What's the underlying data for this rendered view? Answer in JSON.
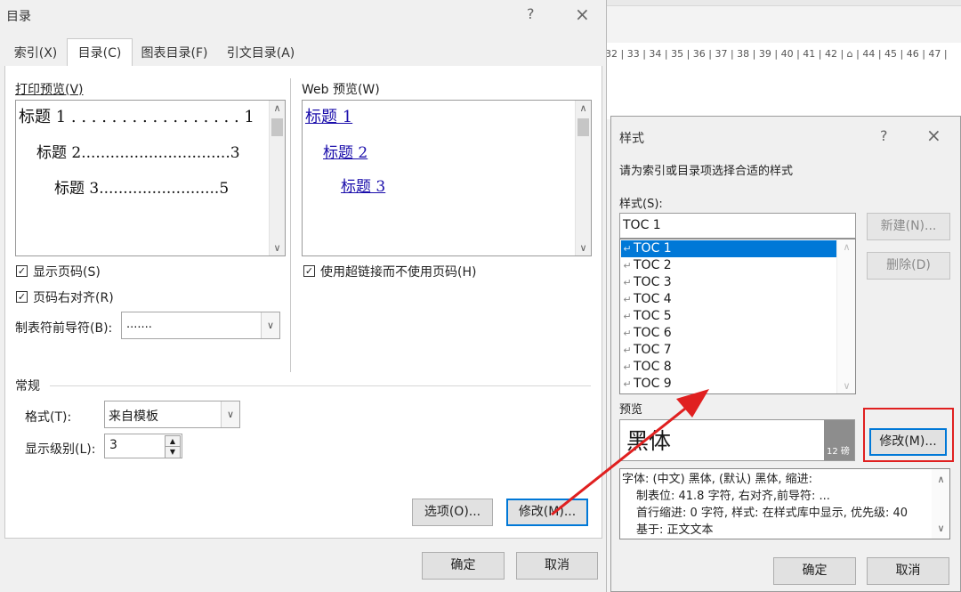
{
  "background": {
    "ruler_text": "32 | 33 | 34 | 35 | 36 | 37 | 38 | 39 | 40 | 41 | 42 |  ⌂ | 44 | 45 | 46 | 47 |"
  },
  "toc_dialog": {
    "title": "目录",
    "help": "?",
    "close": "×",
    "tabs": [
      {
        "label": "索引(X)"
      },
      {
        "label": "目录(C)"
      },
      {
        "label": "图表目录(F)"
      },
      {
        "label": "引文目录(A)"
      }
    ],
    "print_preview": {
      "label": "打印预览(V)",
      "lines": [
        "标题 1 . . . . . . . . . . . . . . . . . 1",
        "标题  2...............................3",
        "标题  3.........................5"
      ]
    },
    "web_preview": {
      "label": "Web 预览(W)",
      "links": [
        "标题 1",
        "标题 2",
        "标题 3"
      ]
    },
    "show_page_numbers": {
      "label": "显示页码(S)",
      "checked": true
    },
    "right_align": {
      "label": "页码右对齐(R)",
      "checked": true
    },
    "tab_leader": {
      "label": "制表符前导符(B):",
      "value": "......."
    },
    "use_hyperlinks": {
      "label": "使用超链接而不使用页码(H)",
      "checked": true
    },
    "general": {
      "label": "常规",
      "format_label": "格式(T):",
      "format_value": "来自模板",
      "levels_label": "显示级别(L):",
      "levels_value": "3"
    },
    "options_button": "选项(O)...",
    "modify_button": "修改(M)...",
    "ok_button": "确定",
    "cancel_button": "取消"
  },
  "style_dialog": {
    "title": "样式",
    "help": "?",
    "close": "×",
    "instruction": "请为索引或目录项选择合适的样式",
    "styles_label": "样式(S):",
    "style_input": "TOC 1",
    "items": [
      "TOC 1",
      "TOC 2",
      "TOC 3",
      "TOC 4",
      "TOC 5",
      "TOC 6",
      "TOC 7",
      "TOC 8",
      "TOC 9"
    ],
    "selected_index": 0,
    "new_button": "新建(N)...",
    "delete_button": "删除(D)",
    "preview_label": "预览",
    "preview_text": "黑体",
    "preview_size": "12 磅",
    "modify_button": "修改(M)...",
    "description": [
      "字体: (中文) 黑体, (默认) 黑体, 缩进:",
      "制表位: 41.8 字符, 右对齐,前导符: ...",
      "首行缩进: 0 字符, 样式: 在样式库中显示, 优先级: 40",
      "基于: 正文文本"
    ],
    "ok_button": "确定",
    "cancel_button": "取消"
  },
  "colors": {
    "accent": "#0078d7",
    "annotation_red": "#e02020",
    "link": "#1a0dab"
  }
}
